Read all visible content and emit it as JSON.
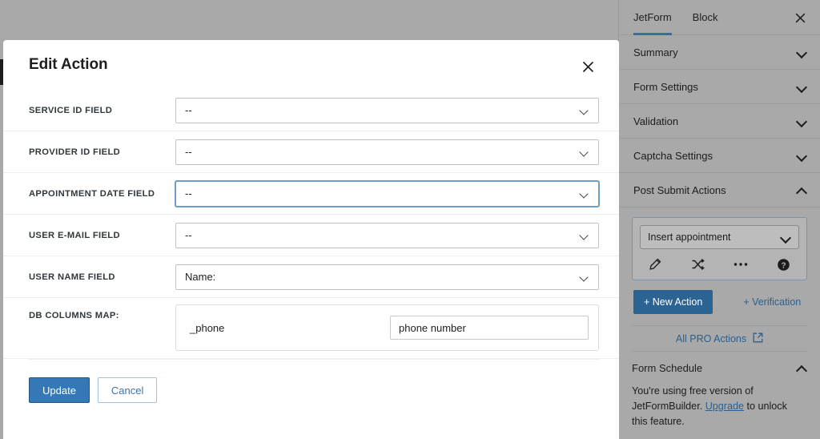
{
  "modal": {
    "title": "Edit Action",
    "close_icon": "close-icon",
    "fields": [
      {
        "label": "SERVICE ID FIELD",
        "value": "--",
        "focused": false
      },
      {
        "label": "PROVIDER ID FIELD",
        "value": "--",
        "focused": false
      },
      {
        "label": "APPOINTMENT DATE FIELD",
        "value": "--",
        "focused": true
      },
      {
        "label": "USER E-MAIL FIELD",
        "value": "--",
        "focused": false
      },
      {
        "label": "USER NAME FIELD",
        "value": "Name:",
        "focused": false
      }
    ],
    "db_columns_map": {
      "label": "DB COLUMNS MAP:",
      "key": "_phone",
      "input_value": "phone number",
      "input_placeholder": "phone number"
    },
    "footer": {
      "update_label": "Update",
      "cancel_label": "Cancel"
    }
  },
  "sidebar": {
    "tabs": [
      {
        "label": "JetForm",
        "active": true
      },
      {
        "label": "Block",
        "active": false
      }
    ],
    "close_icon": "close-icon",
    "panels": [
      {
        "label": "Summary",
        "expanded": false
      },
      {
        "label": "Form Settings",
        "expanded": false
      },
      {
        "label": "Validation",
        "expanded": false
      },
      {
        "label": "Captcha Settings",
        "expanded": false
      },
      {
        "label": "Post Submit Actions",
        "expanded": true
      }
    ],
    "action_card": {
      "selected_action": "Insert appointment",
      "icons": [
        "pencil-icon",
        "shuffle-icon",
        "ellipsis-icon",
        "help-icon"
      ]
    },
    "new_action_label": "+ New Action",
    "verification_label": "+ Verification",
    "all_pro_actions_label": "All PRO Actions",
    "form_schedule": {
      "label": "Form Schedule",
      "expanded": true,
      "notice_before": "You're using free version of JetFormBuilder. ",
      "notice_link": "Upgrade",
      "notice_after": " to unlock this feature."
    }
  },
  "colors": {
    "accent_blue": "#2b6393",
    "link_blue": "#2b5f8f",
    "update_blue": "#3479b5",
    "overlay_gray": "#a9a9a9"
  }
}
